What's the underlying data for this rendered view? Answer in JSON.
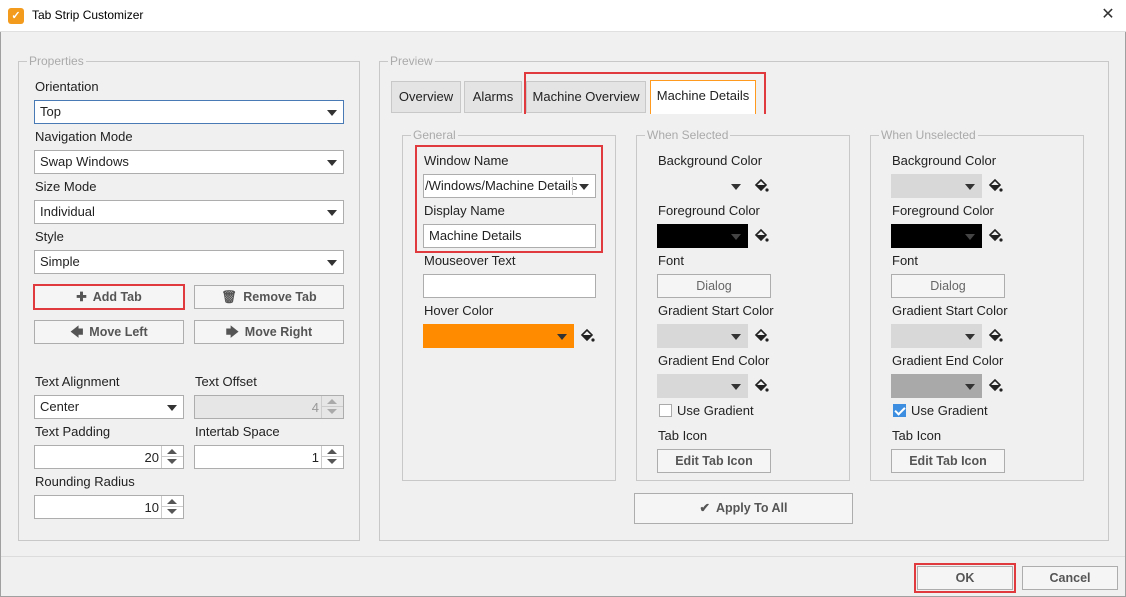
{
  "window": {
    "title": "Tab Strip Customizer"
  },
  "properties": {
    "legend": "Properties",
    "orientation": {
      "label": "Orientation",
      "value": "Top"
    },
    "navigation_mode": {
      "label": "Navigation Mode",
      "value": "Swap Windows"
    },
    "size_mode": {
      "label": "Size Mode",
      "value": "Individual"
    },
    "style": {
      "label": "Style",
      "value": "Simple"
    },
    "buttons": {
      "add_tab": "Add Tab",
      "remove_tab": "Remove Tab",
      "move_left": "Move Left",
      "move_right": "Move Right"
    },
    "text_alignment": {
      "label": "Text Alignment",
      "value": "Center"
    },
    "text_offset": {
      "label": "Text Offset",
      "value": "4"
    },
    "text_padding": {
      "label": "Text Padding",
      "value": "20"
    },
    "intertab_space": {
      "label": "Intertab Space",
      "value": "1"
    },
    "rounding_radius": {
      "label": "Rounding Radius",
      "value": "10"
    }
  },
  "preview": {
    "legend": "Preview",
    "tabs": [
      {
        "label": "Overview"
      },
      {
        "label": "Alarms"
      },
      {
        "label": "Machine Overview"
      },
      {
        "label": "Machine Details"
      }
    ],
    "selected_tab": "Machine Details",
    "general": {
      "legend": "General",
      "window_name": {
        "label": "Window Name",
        "value": "/Windows/Machine Details"
      },
      "display_name": {
        "label": "Display Name",
        "value": "Machine Details"
      },
      "mouseover_text": {
        "label": "Mouseover Text",
        "value": ""
      },
      "hover_color": {
        "label": "Hover Color",
        "color": "#ff8c00"
      }
    },
    "when_selected": {
      "legend": "When Selected",
      "background_color": {
        "label": "Background Color",
        "color": "transparent"
      },
      "foreground_color": {
        "label": "Foreground Color",
        "color": "#000000"
      },
      "font": {
        "label": "Font",
        "value": "Dialog"
      },
      "gradient_start": {
        "label": "Gradient Start Color",
        "color": "#d8d8d8"
      },
      "gradient_end": {
        "label": "Gradient End Color",
        "color": "#d8d8d8"
      },
      "use_gradient": {
        "label": "Use Gradient",
        "checked": false
      },
      "tab_icon": {
        "label": "Tab Icon",
        "button": "Edit Tab Icon"
      }
    },
    "when_unselected": {
      "legend": "When Unselected",
      "background_color": {
        "label": "Background Color",
        "color": "#d8d8d8"
      },
      "foreground_color": {
        "label": "Foreground Color",
        "color": "#000000"
      },
      "font": {
        "label": "Font",
        "value": "Dialog"
      },
      "gradient_start": {
        "label": "Gradient Start Color",
        "color": "#d8d8d8"
      },
      "gradient_end": {
        "label": "Gradient End Color",
        "color": "#a9a9a9"
      },
      "use_gradient": {
        "label": "Use Gradient",
        "checked": true
      },
      "tab_icon": {
        "label": "Tab Icon",
        "button": "Edit Tab Icon"
      }
    },
    "apply_to_all": "Apply To All"
  },
  "footer": {
    "ok": "OK",
    "cancel": "Cancel"
  },
  "colors": {
    "highlight_box": "#e0393e",
    "selected_tab_border": "#ff9a1f",
    "checkbox_accent": "#3d8ee0"
  },
  "icons": {
    "app": "tab-strip-app-icon",
    "close": "close-icon",
    "add": "plus-icon",
    "remove": "trash-icon",
    "left": "arrow-left-icon",
    "right": "arrow-right-icon",
    "bucket": "paint-bucket-icon",
    "check": "checkmark-icon"
  }
}
